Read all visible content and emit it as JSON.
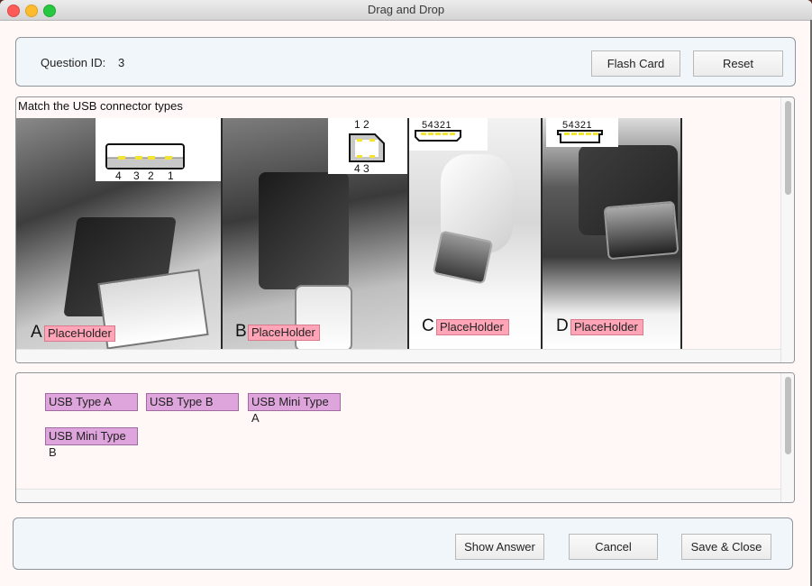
{
  "window": {
    "title": "Drag and Drop"
  },
  "header": {
    "question_id_label": "Question ID:",
    "question_id_value": "3",
    "flash_card_label": "Flash Card",
    "reset_label": "Reset"
  },
  "question": {
    "prompt": "Match the USB connector types",
    "items": [
      {
        "letter": "A",
        "placeholder": "PlaceHolder",
        "pins_top": "",
        "pins_bottom": "4  3  2  1"
      },
      {
        "letter": "B",
        "placeholder": "PlaceHolder",
        "pins_top": "1 2",
        "pins_bottom": "4 3"
      },
      {
        "letter": "C",
        "placeholder": "PlaceHolder",
        "pins_top": "54321",
        "pins_bottom": ""
      },
      {
        "letter": "D",
        "placeholder": "PlaceHolder",
        "pins_top": "54321",
        "pins_bottom": ""
      }
    ]
  },
  "answers": {
    "options": [
      "USB Type A",
      "USB Type B",
      "USB Mini Type A",
      "USB Mini Type B"
    ]
  },
  "footer": {
    "show_answer_label": "Show Answer",
    "cancel_label": "Cancel",
    "save_close_label": "Save & Close"
  },
  "colors": {
    "placeholder_bg": "#ffa5b7",
    "chip_bg": "#dea4dc",
    "panel_bg": "#f1f6fa",
    "window_bg": "#fff8f7"
  }
}
